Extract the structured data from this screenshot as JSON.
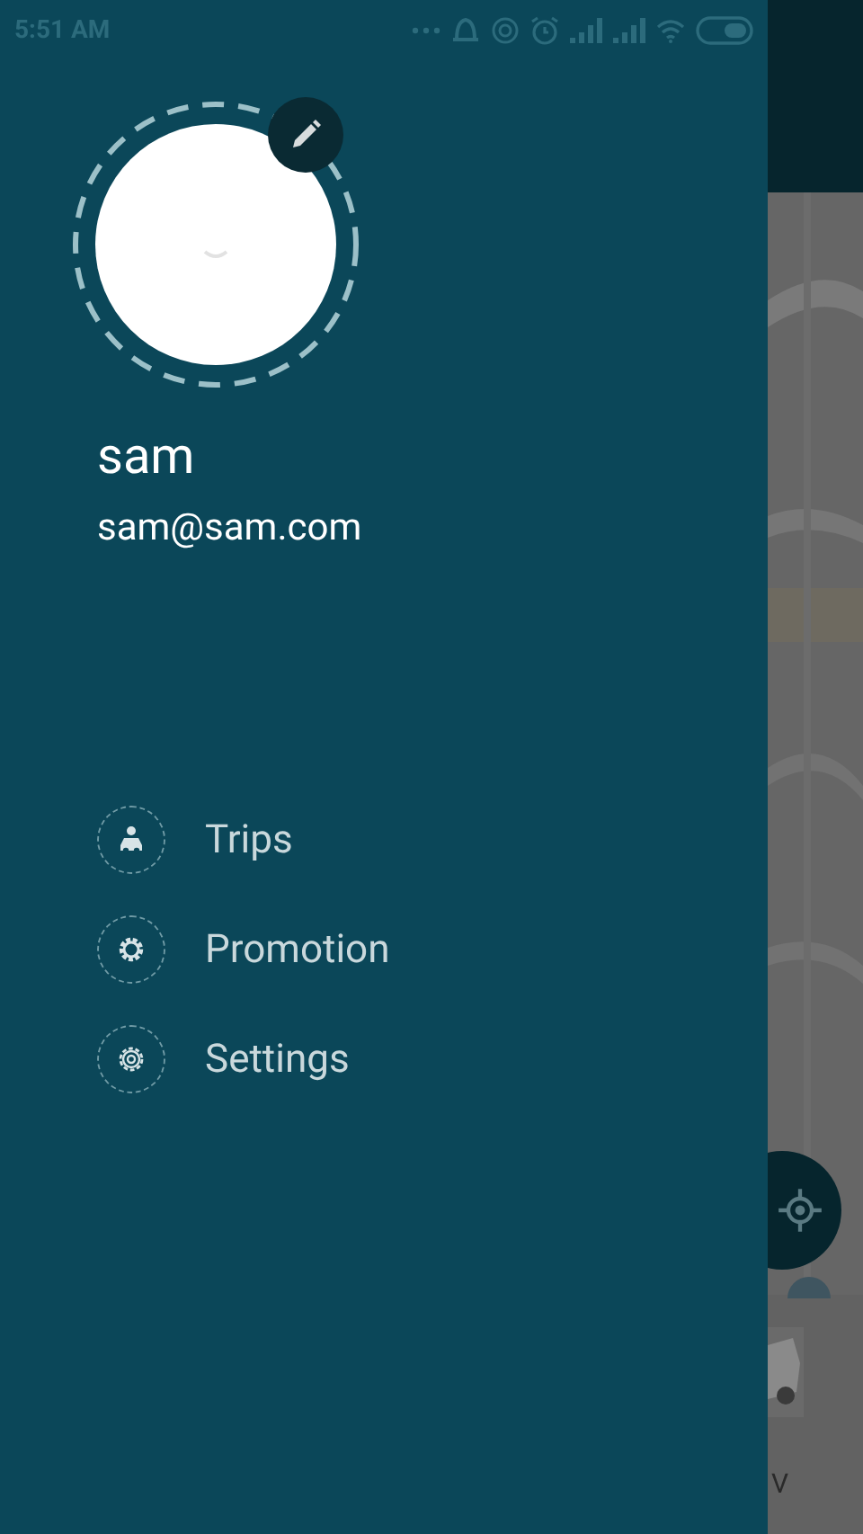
{
  "status_bar": {
    "time": "5:51 AM"
  },
  "profile": {
    "name": "sam",
    "email": "sam@sam.com"
  },
  "menu": [
    {
      "label": "Trips",
      "kind": "trips"
    },
    {
      "label": "Promotion",
      "kind": "promotion"
    },
    {
      "label": "Settings",
      "kind": "settings"
    }
  ],
  "background_screen": {
    "vehicle_label": "V"
  }
}
